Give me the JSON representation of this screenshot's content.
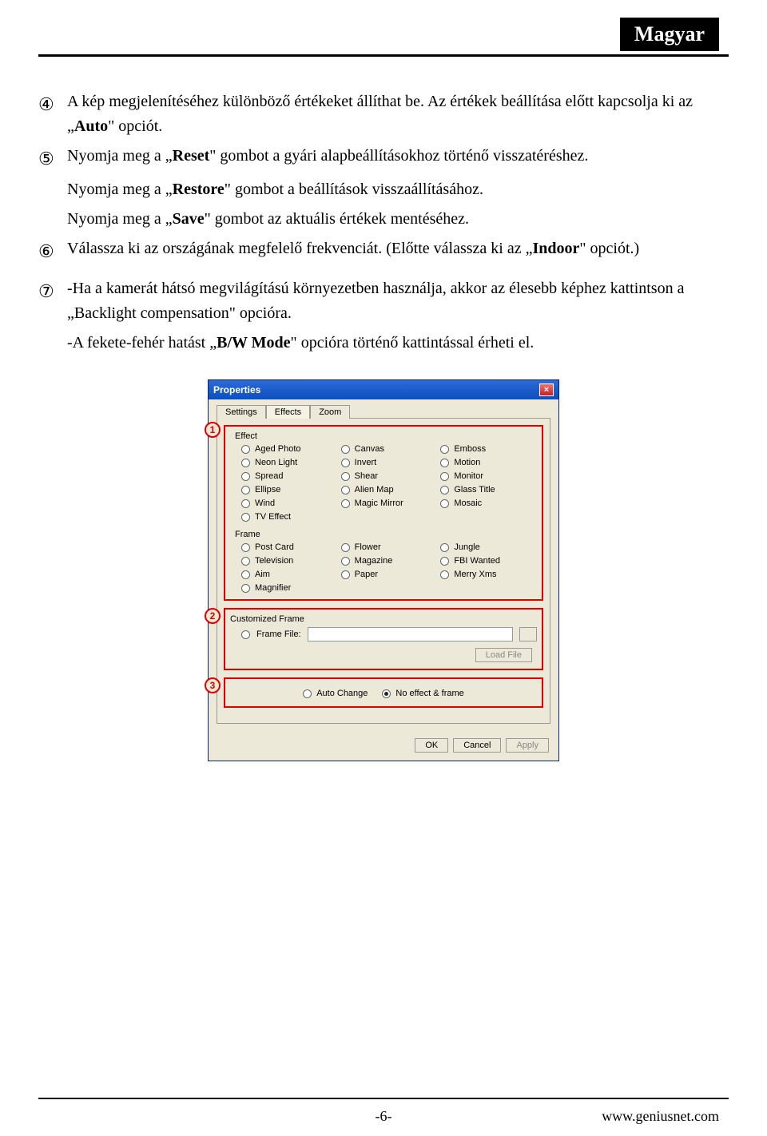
{
  "header": {
    "badge": "Magyar"
  },
  "items": {
    "i4": {
      "marker": "④",
      "runs": [
        {
          "t": "A kép megjelenítéséhez különböző értékeket állíthat be. Az értékek beállítása előtt kapcsolja ki az „"
        },
        {
          "t": "Auto",
          "bold": true
        },
        {
          "t": "\" opciót."
        }
      ]
    },
    "i5": {
      "marker": "⑤",
      "runs": [
        {
          "t": "Nyomja meg a „"
        },
        {
          "t": "Reset",
          "bold": true
        },
        {
          "t": "\" gombot a gyári alapbeállításokhoz történő visszatéréshez."
        }
      ],
      "sub1": [
        {
          "t": "Nyomja meg a „"
        },
        {
          "t": "Restore",
          "bold": true
        },
        {
          "t": "\" gombot a beállítások visszaállításához."
        }
      ],
      "sub2": [
        {
          "t": "Nyomja meg a „"
        },
        {
          "t": "Save",
          "bold": true
        },
        {
          "t": "\" gombot az aktuális értékek mentéséhez."
        }
      ]
    },
    "i6": {
      "marker": "⑥",
      "runs": [
        {
          "t": "Válassza ki az országának megfelelő frekvenciát. (Előtte válassza ki az „"
        },
        {
          "t": "Indoor",
          "bold": true
        },
        {
          "t": "\" opciót.)"
        }
      ]
    },
    "i7": {
      "marker": "⑦",
      "runs": [
        {
          "t": "-Ha a kamerát hátsó megvilágítású környezetben használja, akkor az élesebb képhez kattintson a „Backlight compensation\" opcióra."
        }
      ],
      "sub1": [
        {
          "t": "-A fekete-fehér hatást „"
        },
        {
          "t": "B/W Mode",
          "bold": true
        },
        {
          "t": "\" opcióra történő kattintással érheti el."
        }
      ]
    }
  },
  "dialog": {
    "title": "Properties",
    "tabs": [
      "Settings",
      "Effects",
      "Zoom"
    ],
    "activeTab": 1,
    "callouts": [
      "1",
      "2",
      "3"
    ],
    "effect": {
      "label": "Effect",
      "opts": [
        "Aged Photo",
        "Canvas",
        "Emboss",
        "Neon Light",
        "Invert",
        "Motion",
        "Spread",
        "Shear",
        "Monitor",
        "Ellipse",
        "Alien Map",
        "Glass Title",
        "Wind",
        "Magic Mirror",
        "Mosaic",
        "TV Effect"
      ]
    },
    "frame": {
      "label": "Frame",
      "opts": [
        "Post Card",
        "Flower",
        "Jungle",
        "Television",
        "Magazine",
        "FBI Wanted",
        "Aim",
        "Paper",
        "Merry Xms",
        "Magnifier"
      ]
    },
    "custom": {
      "label": "Customized Frame",
      "frame_file_label": "Frame File:",
      "load_btn": "Load File"
    },
    "auto": {
      "auto_label": "Auto Change",
      "noef_label": "No effect & frame"
    },
    "buttons": {
      "ok": "OK",
      "cancel": "Cancel",
      "apply": "Apply"
    }
  },
  "footer": {
    "page": "-6-",
    "url": "www.geniusnet.com"
  }
}
